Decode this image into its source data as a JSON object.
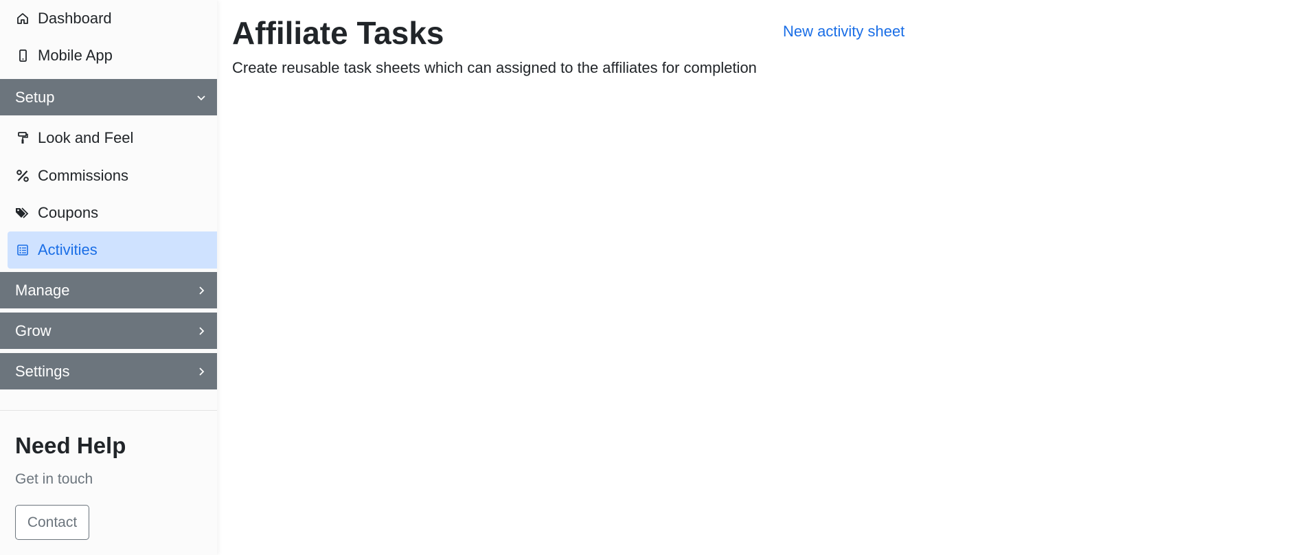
{
  "sidebar": {
    "top_items": [
      {
        "label": "Dashboard",
        "icon": "home-icon"
      },
      {
        "label": "Mobile App",
        "icon": "mobile-phone-icon"
      }
    ],
    "setup": {
      "label": "Setup",
      "expanded": true,
      "items": [
        {
          "label": "Look and Feel",
          "icon": "paint-roller-icon"
        },
        {
          "label": "Commissions",
          "icon": "percent-icon"
        },
        {
          "label": "Coupons",
          "icon": "tags-icon"
        },
        {
          "label": "Activities",
          "icon": "list-icon",
          "active": true
        }
      ]
    },
    "manage": {
      "label": "Manage"
    },
    "grow": {
      "label": "Grow"
    },
    "settings": {
      "label": "Settings"
    },
    "help": {
      "title": "Need Help",
      "subtitle": "Get in touch",
      "contact_label": "Contact"
    }
  },
  "main": {
    "title": "Affiliate Tasks",
    "new_link": "New activity sheet",
    "description": "Create reusable task sheets which can assigned to the affiliates for completion"
  },
  "colors": {
    "section_bg": "#6c757d",
    "active_bg": "#cfe2ff",
    "accent": "#1a6ee6"
  }
}
